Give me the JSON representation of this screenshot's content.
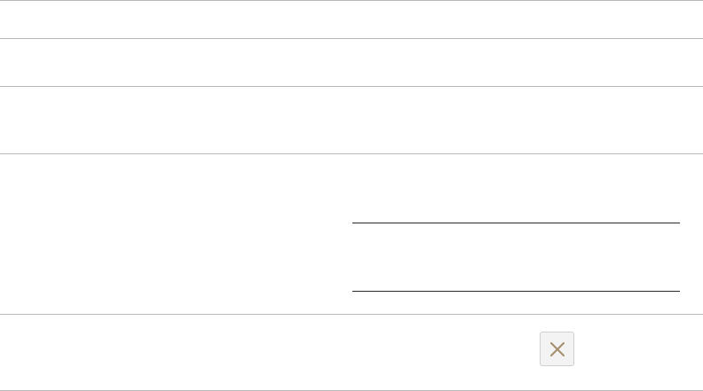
{
  "icons": {
    "remove": "close-icon"
  },
  "colors": {
    "row_border": "#b9b9b9",
    "field_border": "#2b2b2b",
    "button_background": "#f3f3f3",
    "button_border": "#cfcfcf",
    "icon_color": "#a58d6e"
  }
}
